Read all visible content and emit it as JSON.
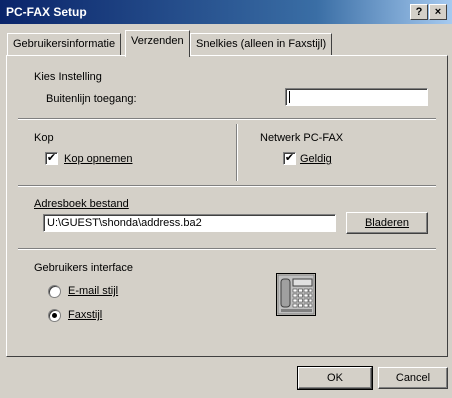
{
  "window": {
    "title": "PC-FAX Setup",
    "help_label": "?",
    "close_label": "×"
  },
  "tabs": [
    {
      "label": "Gebruikersinformatie",
      "active": false
    },
    {
      "label": "Verzenden",
      "active": true
    },
    {
      "label": "Snelkies (alleen in Faxstijl)",
      "active": false
    }
  ],
  "kies": {
    "group_label": "Kies Instelling",
    "buitenlijn_label": "Buitenlijn toegang:",
    "buitenlijn_value": ""
  },
  "kop": {
    "group_label": "Kop",
    "checkbox_label": "Kop opnemen",
    "checked": true
  },
  "netwerk": {
    "group_label": "Netwerk PC-FAX",
    "checkbox_label": "Geldig",
    "checked": true
  },
  "adresboek": {
    "group_label": "Adresboek bestand",
    "path_value": "U:\\GUEST\\shonda\\address.ba2",
    "browse_label": "Bladeren"
  },
  "interface": {
    "group_label": "Gebruikers interface",
    "options": [
      {
        "label": "E-mail stijl",
        "selected": false
      },
      {
        "label": "Faxstijl",
        "selected": true
      }
    ]
  },
  "footer": {
    "ok_label": "OK",
    "cancel_label": "Cancel"
  },
  "icons": {
    "fax_preview": "fax-machine-icon"
  }
}
